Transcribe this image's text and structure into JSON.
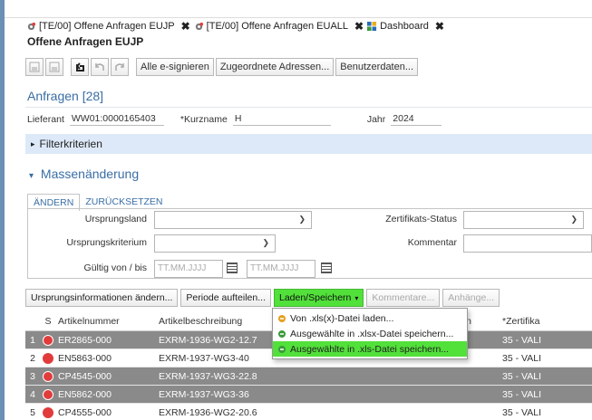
{
  "tabs": [
    {
      "label": "[TE/00] Offene Anfragen EUJP",
      "close": "✖"
    },
    {
      "label": "[TE/00] Offene Anfragen EUALL",
      "close": "✖"
    },
    {
      "label": "Dashboard",
      "close": "✖"
    }
  ],
  "page_title": "Offene Anfragen  EUJP",
  "toolbar": {
    "sign_all": "Alle e-signieren",
    "addresses": "Zugeordnete Adressen...",
    "user_data": "Benutzerdaten..."
  },
  "section": {
    "title": "Anfragen [28]"
  },
  "header_fields": {
    "supplier_label": "Lieferant",
    "supplier_value": "WW01:0000165403",
    "shortname_label": "*Kurzname",
    "shortname_value": "H",
    "year_label": "Jahr",
    "year_value": "2024"
  },
  "filter": {
    "label": "Filterkriterien",
    "arrow": "▸"
  },
  "mass_change": {
    "title": "Massenänderung",
    "arrow": "▾",
    "tab_change": "ÄNDERN",
    "tab_reset": "ZURÜCKSETZEN",
    "origin_country": "Ursprungsland",
    "origin_criterion": "Ursprungskriterium",
    "valid_from_to": "Gültig von / bis",
    "date_placeholder": "TT.MM.JJJJ",
    "cert_status": "Zertifikats-Status",
    "comment": "Kommentar"
  },
  "actions": {
    "origin_info": "Ursprungsinformationen ändern...",
    "split_period": "Periode aufteilen...",
    "load_save": "Laden/Speichern",
    "load_save_caret": "▾",
    "comments": "Kommentare...",
    "attachments": "Anhänge..."
  },
  "menu": [
    {
      "label": "Von .xls(x)-Datei laden..."
    },
    {
      "label": "Ausgewählte in .xlsx-Datei speichern..."
    },
    {
      "label": "Ausgewählte in .xls-Datei speichern..."
    }
  ],
  "grid": {
    "headers": {
      "s": "S",
      "article": "Artikelnummer",
      "desc": "Artikelbeschreibung",
      "partial": "ion",
      "cert": "*Zertifika"
    },
    "rows": [
      {
        "num": "1",
        "article": "ER2865-000",
        "desc": "EXRM-1936-WG2-12.7",
        "cert": "35 - VALI"
      },
      {
        "num": "2",
        "article": "EN5863-000",
        "desc": "EXRM-1937-WG3-40",
        "cert": "35 - VALI"
      },
      {
        "num": "3",
        "article": "CP4545-000",
        "desc": "EXRM-1937-WG3-22.8",
        "cert": "35 - VALI"
      },
      {
        "num": "4",
        "article": "EN5862-000",
        "desc": "EXRM-1937-WG3-36",
        "cert": "35 - VALI"
      },
      {
        "num": "5",
        "article": "CP4555-000",
        "desc": "EXRM-1936-WG2-20.6",
        "cert": "35 - VALI"
      }
    ]
  },
  "colors": {
    "accent": "#3a6ea5",
    "highlight": "#52e03a",
    "selected_row": "#8a8a8a",
    "status_dot": "#e23b3b"
  }
}
